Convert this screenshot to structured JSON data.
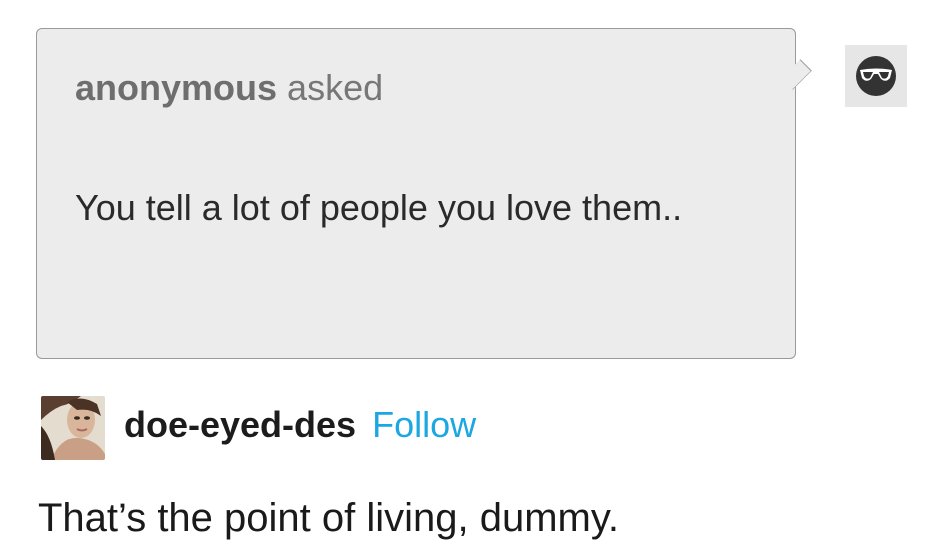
{
  "ask": {
    "asker_name": "anonymous",
    "asked_word": "asked",
    "question": "You tell a lot of people you love them.."
  },
  "answer": {
    "blog_name": "doe-eyed-des",
    "follow_label": "Follow",
    "text": "That’s the point of living, dummy."
  },
  "icons": {
    "anon_avatar": "anonymous-sunglasses-avatar-icon",
    "answerer_avatar": "user-photo-avatar"
  },
  "colors": {
    "bubble_bg": "#ececec",
    "follow_link": "#1ba7e0"
  }
}
